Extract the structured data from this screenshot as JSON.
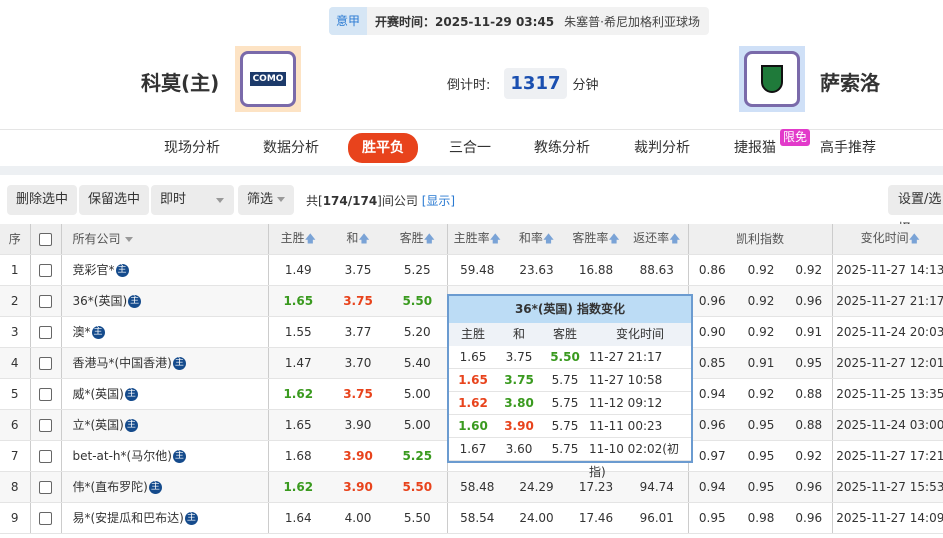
{
  "match": {
    "league": "意甲",
    "kickoff": "开赛时间：2025-11-29 03:45",
    "venue": "朱塞普·希尼加格利亚球场",
    "home": "科莫(主)",
    "away": "萨索洛",
    "home_logo_text": "COMO",
    "countdown_label": "倒计时:",
    "countdown": "1317",
    "countdown_unit": "分钟"
  },
  "nav": {
    "items": [
      "现场分析",
      "数据分析",
      "胜平负",
      "三合一",
      "教练分析",
      "裁判分析",
      "捷报猫",
      "高手推荐"
    ],
    "active": "胜平负",
    "badge": "限免"
  },
  "toolbar": {
    "delete": "删除选中",
    "keep": "保留选中",
    "mode": "即时",
    "filter": "筛选",
    "count_prefix": "共[",
    "count": "174/174",
    "count_suffix": "]间公司",
    "show": "[显示]",
    "settings": "设置/选择"
  },
  "table": {
    "headers": {
      "seq": "序",
      "company": "所有公司",
      "home": "主胜",
      "draw": "和",
      "away": "客胜",
      "home_rate": "主胜率",
      "draw_rate": "和率",
      "away_rate": "客胜率",
      "return": "返还率",
      "kelly": "凯利指数",
      "time": "变化时间"
    },
    "rows": [
      {
        "seq": "1",
        "name": "竞彩官*",
        "odds": [
          "1.49",
          "3.75",
          "5.25"
        ],
        "colors": [
          "",
          "",
          ""
        ],
        "rates": [
          "59.48",
          "23.63",
          "16.88",
          "88.63"
        ],
        "kelly": [
          "0.86",
          "0.92",
          "0.92"
        ],
        "time": "2025-11-27 14:13"
      },
      {
        "seq": "2",
        "name": "36*(英国)",
        "odds": [
          "1.65",
          "3.75",
          "5.50"
        ],
        "colors": [
          "g",
          "r",
          "g"
        ],
        "rates": [
          "",
          "",
          "",
          ""
        ],
        "kelly": [
          "0.96",
          "0.92",
          "0.96"
        ],
        "time": "2025-11-27 21:17"
      },
      {
        "seq": "3",
        "name": "澳*",
        "odds": [
          "1.55",
          "3.77",
          "5.20"
        ],
        "colors": [
          "",
          "",
          ""
        ],
        "rates": [
          "",
          "",
          "",
          ""
        ],
        "kelly": [
          "0.90",
          "0.92",
          "0.91"
        ],
        "time": "2025-11-24 20:03"
      },
      {
        "seq": "4",
        "name": "香港马*(中国香港)",
        "odds": [
          "1.47",
          "3.70",
          "5.40"
        ],
        "colors": [
          "",
          "",
          ""
        ],
        "rates": [
          "",
          "",
          "",
          ""
        ],
        "kelly": [
          "0.85",
          "0.91",
          "0.95"
        ],
        "time": "2025-11-27 12:01"
      },
      {
        "seq": "5",
        "name": "威*(英国)",
        "odds": [
          "1.62",
          "3.75",
          "5.00"
        ],
        "colors": [
          "g",
          "r",
          ""
        ],
        "rates": [
          "",
          "",
          "",
          ""
        ],
        "kelly": [
          "0.94",
          "0.92",
          "0.88"
        ],
        "time": "2025-11-25 13:35"
      },
      {
        "seq": "6",
        "name": "立*(英国)",
        "odds": [
          "1.65",
          "3.90",
          "5.00"
        ],
        "colors": [
          "",
          "",
          ""
        ],
        "rates": [
          "",
          "",
          "",
          ""
        ],
        "kelly": [
          "0.96",
          "0.95",
          "0.88"
        ],
        "time": "2025-11-24 03:00"
      },
      {
        "seq": "7",
        "name": "bet-at-h*(马尔他)",
        "odds": [
          "1.68",
          "3.90",
          "5.25"
        ],
        "colors": [
          "",
          "r",
          "g"
        ],
        "rates": [
          "",
          "",
          "",
          ""
        ],
        "kelly": [
          "0.97",
          "0.95",
          "0.92"
        ],
        "time": "2025-11-27 17:21"
      },
      {
        "seq": "8",
        "name": "伟*(直布罗陀)",
        "odds": [
          "1.62",
          "3.90",
          "5.50"
        ],
        "colors": [
          "g",
          "r",
          "r"
        ],
        "rates": [
          "58.48",
          "24.29",
          "17.23",
          "94.74"
        ],
        "kelly": [
          "0.94",
          "0.95",
          "0.96"
        ],
        "time": "2025-11-27 15:53"
      },
      {
        "seq": "9",
        "name": "易*(安提瓜和巴布达)",
        "odds": [
          "1.64",
          "4.00",
          "5.50"
        ],
        "colors": [
          "",
          "",
          ""
        ],
        "rates": [
          "58.54",
          "24.00",
          "17.46",
          "96.01"
        ],
        "kelly": [
          "0.95",
          "0.98",
          "0.96"
        ],
        "time": "2025-11-27 14:09"
      }
    ],
    "zhu_label": "主"
  },
  "popup": {
    "title": "36*(英国) 指数变化",
    "headers": [
      "主胜",
      "和",
      "客胜",
      "变化时间"
    ],
    "rows": [
      {
        "v": [
          "1.65",
          "3.75",
          "5.50",
          "11-27 21:17"
        ],
        "c": [
          "",
          "",
          "g",
          ""
        ]
      },
      {
        "v": [
          "1.65",
          "3.75",
          "5.75",
          "11-27 10:58"
        ],
        "c": [
          "r",
          "g",
          "",
          ""
        ]
      },
      {
        "v": [
          "1.62",
          "3.80",
          "5.75",
          "11-12 09:12"
        ],
        "c": [
          "r",
          "g",
          "",
          ""
        ]
      },
      {
        "v": [
          "1.60",
          "3.90",
          "5.75",
          "11-11 00:23"
        ],
        "c": [
          "g",
          "r",
          "",
          ""
        ]
      },
      {
        "v": [
          "1.67",
          "3.60",
          "5.75",
          "11-10 02:02(初指)"
        ],
        "c": [
          "",
          "",
          "",
          ""
        ]
      }
    ]
  },
  "colors": {
    "accent": "#e8431c",
    "up": "#3a9a1f",
    "down": "#e8431c",
    "link": "#2a7ad2"
  }
}
